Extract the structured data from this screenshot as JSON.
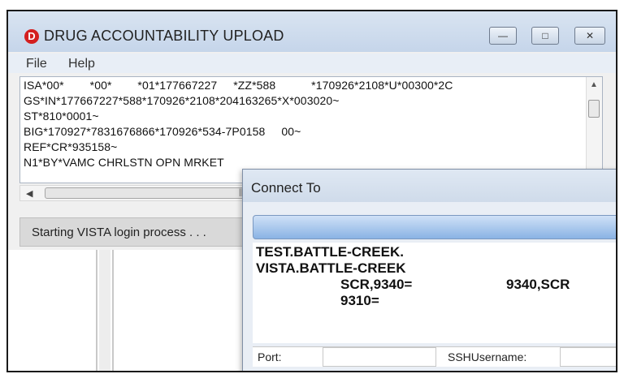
{
  "main_window": {
    "title": "DRUG ACCOUNTABILITY UPLOAD",
    "app_icon_letter": "D",
    "menu": [
      {
        "label": "File"
      },
      {
        "label": "Help"
      }
    ],
    "edi_lines": [
      "ISA*00*        *00*        *01*177667227     *ZZ*588           *170926*2108*U*00300*2C",
      "GS*IN*177667227*588*170926*2108*204163265*X*003020~",
      "ST*810*0001~",
      "BIG*170927*7831676866*170926*534-7P0158     00~",
      "REF*CR*935158~",
      "N1*BY*VAMC CHRLSTN OPN MRKET"
    ],
    "status_text": "Starting VISTA login process . . ."
  },
  "dialog": {
    "title": "Connect To",
    "servers": [
      "TEST.BATTLE-CREEK.",
      "VISTA.BATTLE-CREEK",
      "SCR,9340=",
      "9340,SCR",
      "9310="
    ],
    "fields": {
      "port_label": "Port:",
      "ssh_username_label": "SSHUsername:"
    }
  }
}
